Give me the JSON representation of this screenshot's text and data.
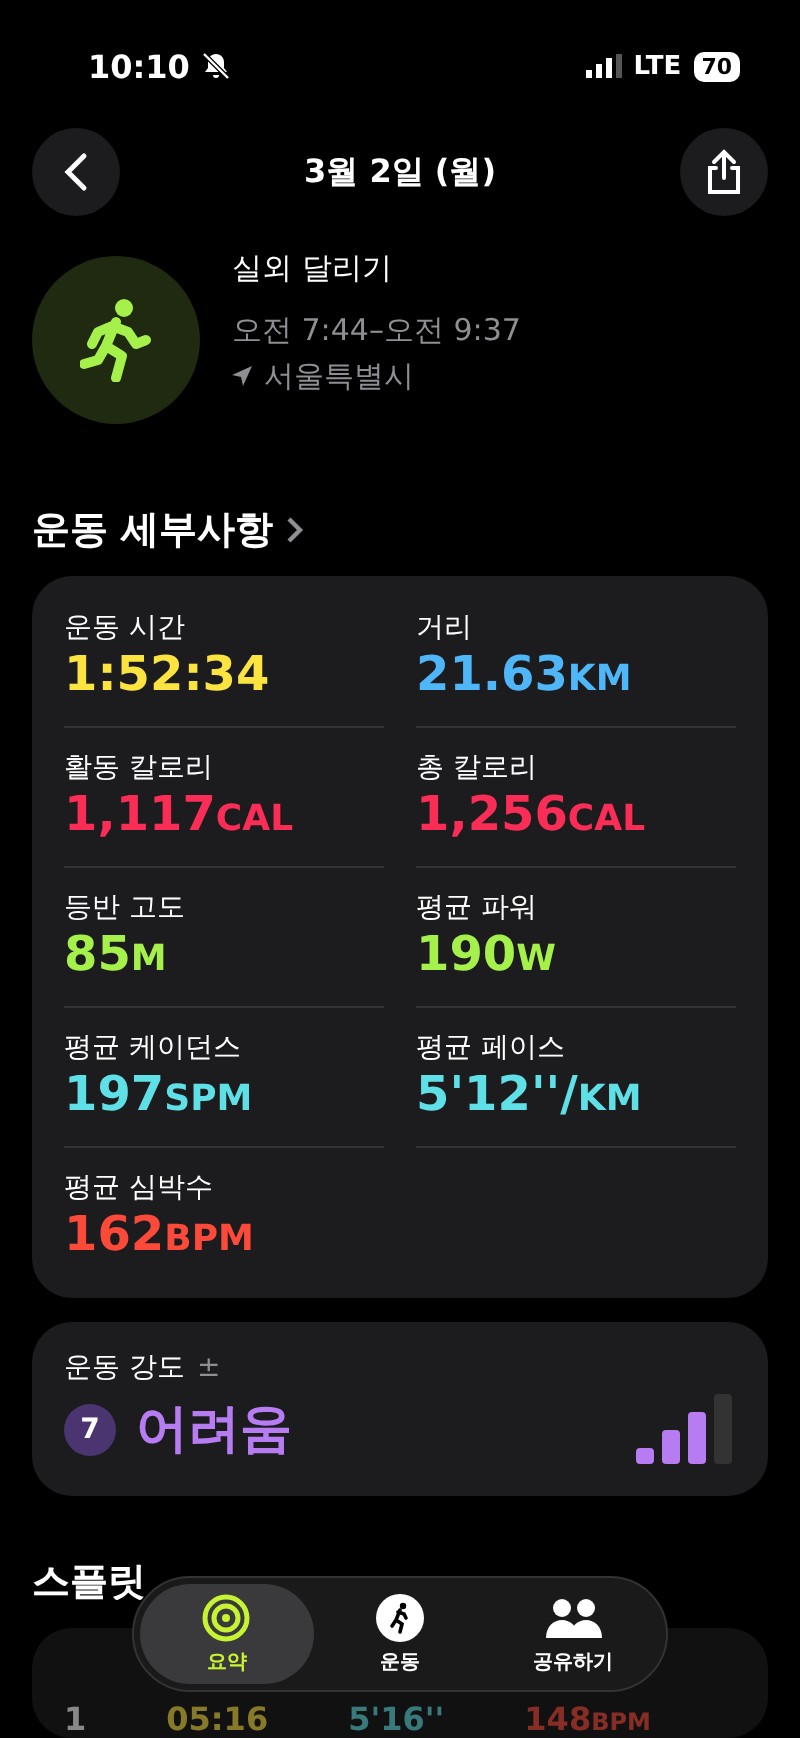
{
  "status_bar": {
    "time": "10:10",
    "network": "LTE",
    "battery": "70"
  },
  "nav": {
    "title": "3월 2일 (월)"
  },
  "workout": {
    "name": "실외 달리기",
    "time_range": "오전 7:44–오전 9:37",
    "location": "서울특별시"
  },
  "details": {
    "title": "운동 세부사항",
    "metrics": [
      {
        "label": "운동 시간",
        "value": "1:52:34",
        "color": "#fbe340"
      },
      {
        "label": "거리",
        "value": "21.63",
        "unit": "KM",
        "color": "#4fb6f7"
      },
      {
        "label": "활동 칼로리",
        "value": "1,117",
        "unit": "CAL",
        "color": "#fa2d57"
      },
      {
        "label": "총 칼로리",
        "value": "1,256",
        "unit": "CAL",
        "color": "#fa2d57"
      },
      {
        "label": "등반 고도",
        "value": "85",
        "unit": "M",
        "color": "#a5f04a"
      },
      {
        "label": "평균 파워",
        "value": "190",
        "unit": "W",
        "color": "#a5f04a"
      },
      {
        "label": "평균 케이던스",
        "value": "197",
        "unit": "SPM",
        "color": "#5fe0e6"
      },
      {
        "label": "평균 페이스",
        "value": "5'12''/",
        "unit": "KM",
        "color": "#5fe0e6"
      },
      {
        "label": "평균 심박수",
        "value": "162",
        "unit": "BPM",
        "color": "#fb4a3a"
      }
    ]
  },
  "intensity": {
    "label": "운동 강도",
    "adjust": "±",
    "score": "7",
    "rating": "어려움",
    "level": 0.7
  },
  "splits": {
    "title": "스플릿",
    "rows": [
      {
        "index": "1",
        "time": "05:16",
        "pace": "5'16''",
        "heart_rate": "148",
        "heart_unit": "BPM"
      }
    ]
  },
  "tab_bar": [
    {
      "label": "요약",
      "kind": "summary",
      "selected": true
    },
    {
      "label": "운동",
      "kind": "workout",
      "selected": false
    },
    {
      "label": "공유하기",
      "kind": "share",
      "selected": false
    }
  ]
}
